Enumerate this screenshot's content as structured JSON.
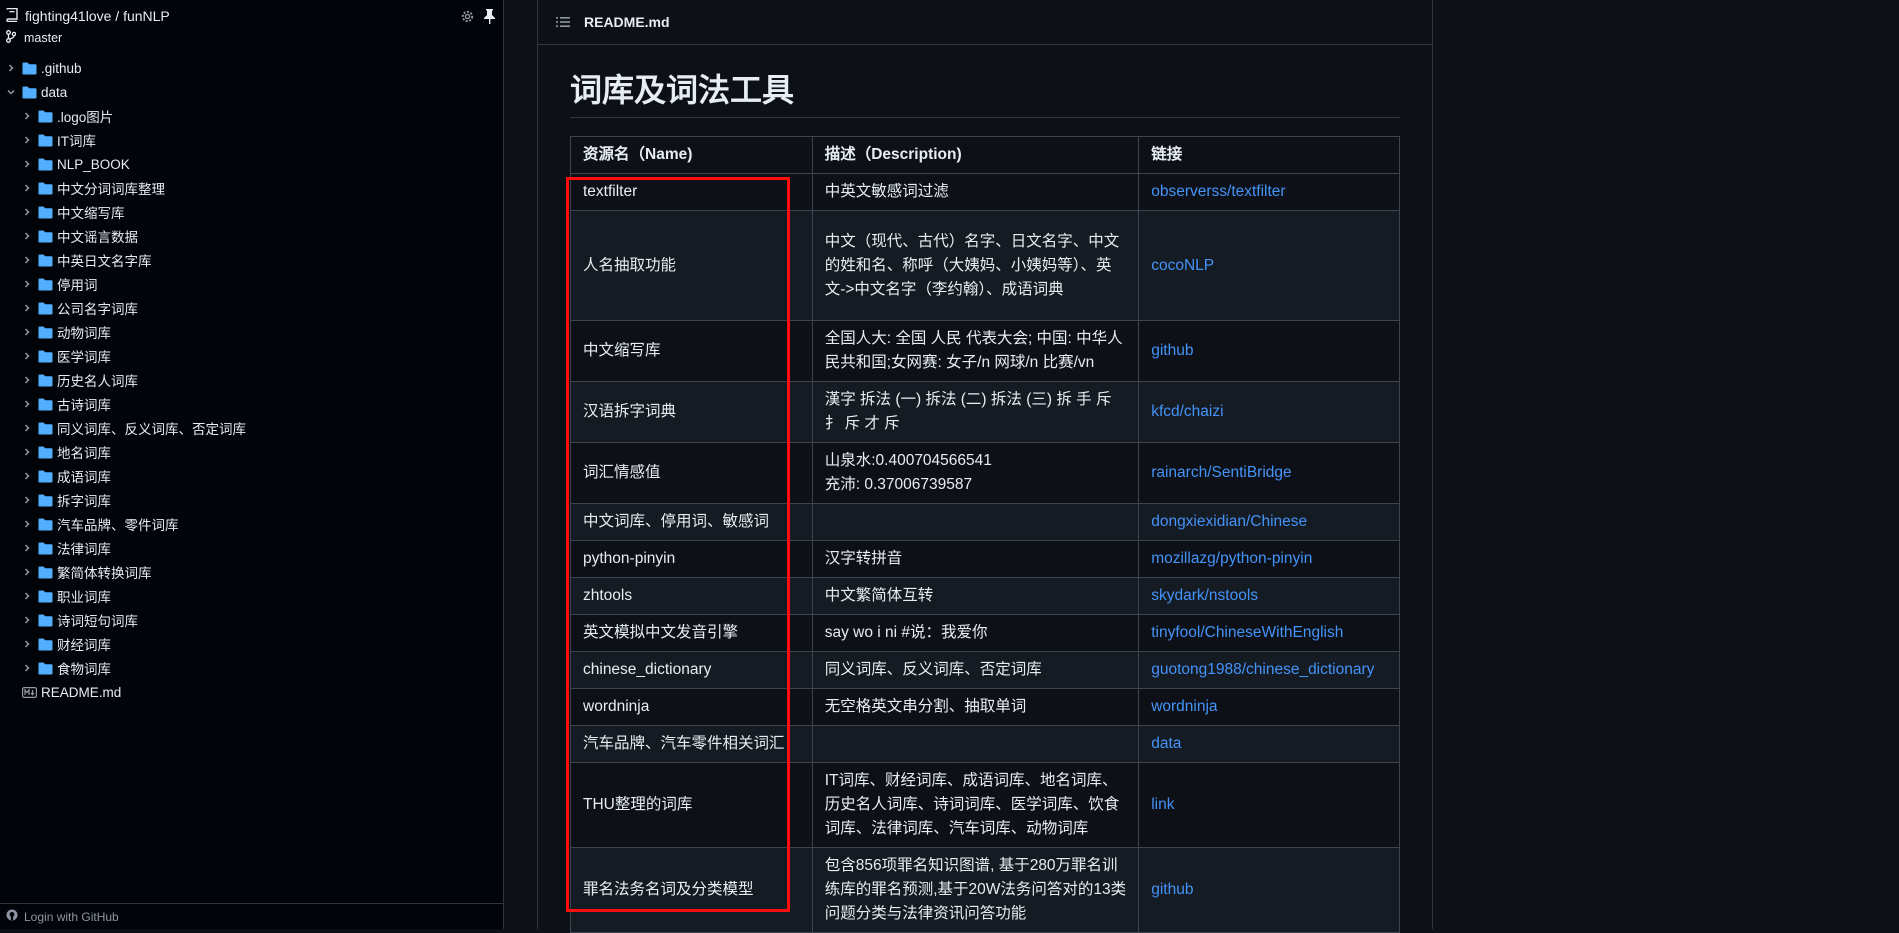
{
  "sidebar": {
    "repo": "fighting41love / funNLP",
    "branch": "master",
    "tree": [
      {
        "label": ".github",
        "level": 0,
        "type": "folder",
        "expanded": false
      },
      {
        "label": "data",
        "level": 0,
        "type": "folder",
        "expanded": true
      },
      {
        "label": ".logo图片",
        "level": 1,
        "type": "folder",
        "expanded": false
      },
      {
        "label": "IT词库",
        "level": 1,
        "type": "folder",
        "expanded": false
      },
      {
        "label": "NLP_BOOK",
        "level": 1,
        "type": "folder",
        "expanded": false
      },
      {
        "label": "中文分词词库整理",
        "level": 1,
        "type": "folder",
        "expanded": false
      },
      {
        "label": "中文缩写库",
        "level": 1,
        "type": "folder",
        "expanded": false
      },
      {
        "label": "中文谣言数据",
        "level": 1,
        "type": "folder",
        "expanded": false
      },
      {
        "label": "中英日文名字库",
        "level": 1,
        "type": "folder",
        "expanded": false
      },
      {
        "label": "停用词",
        "level": 1,
        "type": "folder",
        "expanded": false
      },
      {
        "label": "公司名字词库",
        "level": 1,
        "type": "folder",
        "expanded": false
      },
      {
        "label": "动物词库",
        "level": 1,
        "type": "folder",
        "expanded": false
      },
      {
        "label": "医学词库",
        "level": 1,
        "type": "folder",
        "expanded": false
      },
      {
        "label": "历史名人词库",
        "level": 1,
        "type": "folder",
        "expanded": false
      },
      {
        "label": "古诗词库",
        "level": 1,
        "type": "folder",
        "expanded": false
      },
      {
        "label": "同义词库、反义词库、否定词库",
        "level": 1,
        "type": "folder",
        "expanded": false
      },
      {
        "label": "地名词库",
        "level": 1,
        "type": "folder",
        "expanded": false
      },
      {
        "label": "成语词库",
        "level": 1,
        "type": "folder",
        "expanded": false
      },
      {
        "label": "拆字词库",
        "level": 1,
        "type": "folder",
        "expanded": false
      },
      {
        "label": "汽车品牌、零件词库",
        "level": 1,
        "type": "folder",
        "expanded": false
      },
      {
        "label": "法律词库",
        "level": 1,
        "type": "folder",
        "expanded": false
      },
      {
        "label": "繁简体转换词库",
        "level": 1,
        "type": "folder",
        "expanded": false
      },
      {
        "label": "职业词库",
        "level": 1,
        "type": "folder",
        "expanded": false
      },
      {
        "label": "诗词短句词库",
        "level": 1,
        "type": "folder",
        "expanded": false
      },
      {
        "label": "财经词库",
        "level": 1,
        "type": "folder",
        "expanded": false
      },
      {
        "label": "食物词库",
        "level": 1,
        "type": "folder",
        "expanded": false
      },
      {
        "label": "README.md",
        "level": 0,
        "type": "file",
        "expanded": false
      }
    ],
    "footer": "Login with GitHub"
  },
  "main": {
    "file_name": "README.md",
    "heading": "词库及词法工具",
    "table": {
      "headers": [
        "资源名（Name)",
        "描述（Description)",
        "链接"
      ],
      "rows": [
        {
          "name": "textfilter",
          "desc": "中英文敏感词过滤",
          "link": "observerss/textfilter",
          "h": 37
        },
        {
          "name": "人名抽取功能",
          "desc": "中文（现代、古代）名字、日文名字、中文的姓和名、称呼（大姨妈、小姨妈等）、英文->中文名字（李约翰）、成语词典",
          "link": "cocoNLP",
          "h": 110
        },
        {
          "name": "中文缩写库",
          "desc": "全国人大: 全国 人民 代表大会; 中国: 中华人民共和国;女网赛: 女子/n 网球/n 比赛/vn",
          "link": "github",
          "h": 61
        },
        {
          "name": "汉语拆字词典",
          "desc": "漢字 拆法 (一) 拆法 (二) 拆法 (三) 拆 手 斥 扌 斥 才 斥",
          "link": "kfcd/chaizi",
          "h": 61
        },
        {
          "name": "词汇情感值",
          "desc": "山泉水:0.400704566541\n充沛: 0.37006739587",
          "link": "rainarch/SentiBridge",
          "h": 61
        },
        {
          "name": "中文词库、停用词、敏感词",
          "desc": "",
          "link": "dongxiexidian/Chinese",
          "h": 37
        },
        {
          "name": "python-pinyin",
          "desc": "汉字转拼音",
          "link": "mozillazg/python-pinyin",
          "h": 37
        },
        {
          "name": "zhtools",
          "desc": "中文繁简体互转",
          "link": "skydark/nstools",
          "h": 37
        },
        {
          "name": "英文模拟中文发音引擎",
          "desc": "say wo i ni #说：我爱你",
          "link": "tinyfool/ChineseWithEnglish",
          "h": 37
        },
        {
          "name": "chinese_dictionary",
          "desc": "同义词库、反义词库、否定词库",
          "link": "guotong1988/chinese_dictionary",
          "h": 37
        },
        {
          "name": "wordninja",
          "desc": "无空格英文串分割、抽取单词",
          "link": "wordninja",
          "h": 37
        },
        {
          "name": "汽车品牌、汽车零件相关词汇",
          "desc": "",
          "link": "data",
          "h": 37
        },
        {
          "name": "THU整理的词库",
          "desc": "IT词库、财经词库、成语词库、地名词库、历史名人词库、诗词词库、医学词库、饮食词库、法律词库、汽车词库、动物词库",
          "link": "link",
          "h": 85
        },
        {
          "name": "罪名法务名词及分类模型",
          "desc": "包含856项罪名知识图谱, 基于280万罪名训练库的罪名预测,基于20W法务问答对的13类问题分类与法律资讯问答功能",
          "link": "github",
          "h": 85
        }
      ]
    }
  },
  "colors": {
    "background": "#0d1117",
    "sidebar_bg": "#010409",
    "border": "#30363d",
    "link": "#4493f8",
    "folder": "#54aeff",
    "highlight_box": "#ff0d0d"
  }
}
